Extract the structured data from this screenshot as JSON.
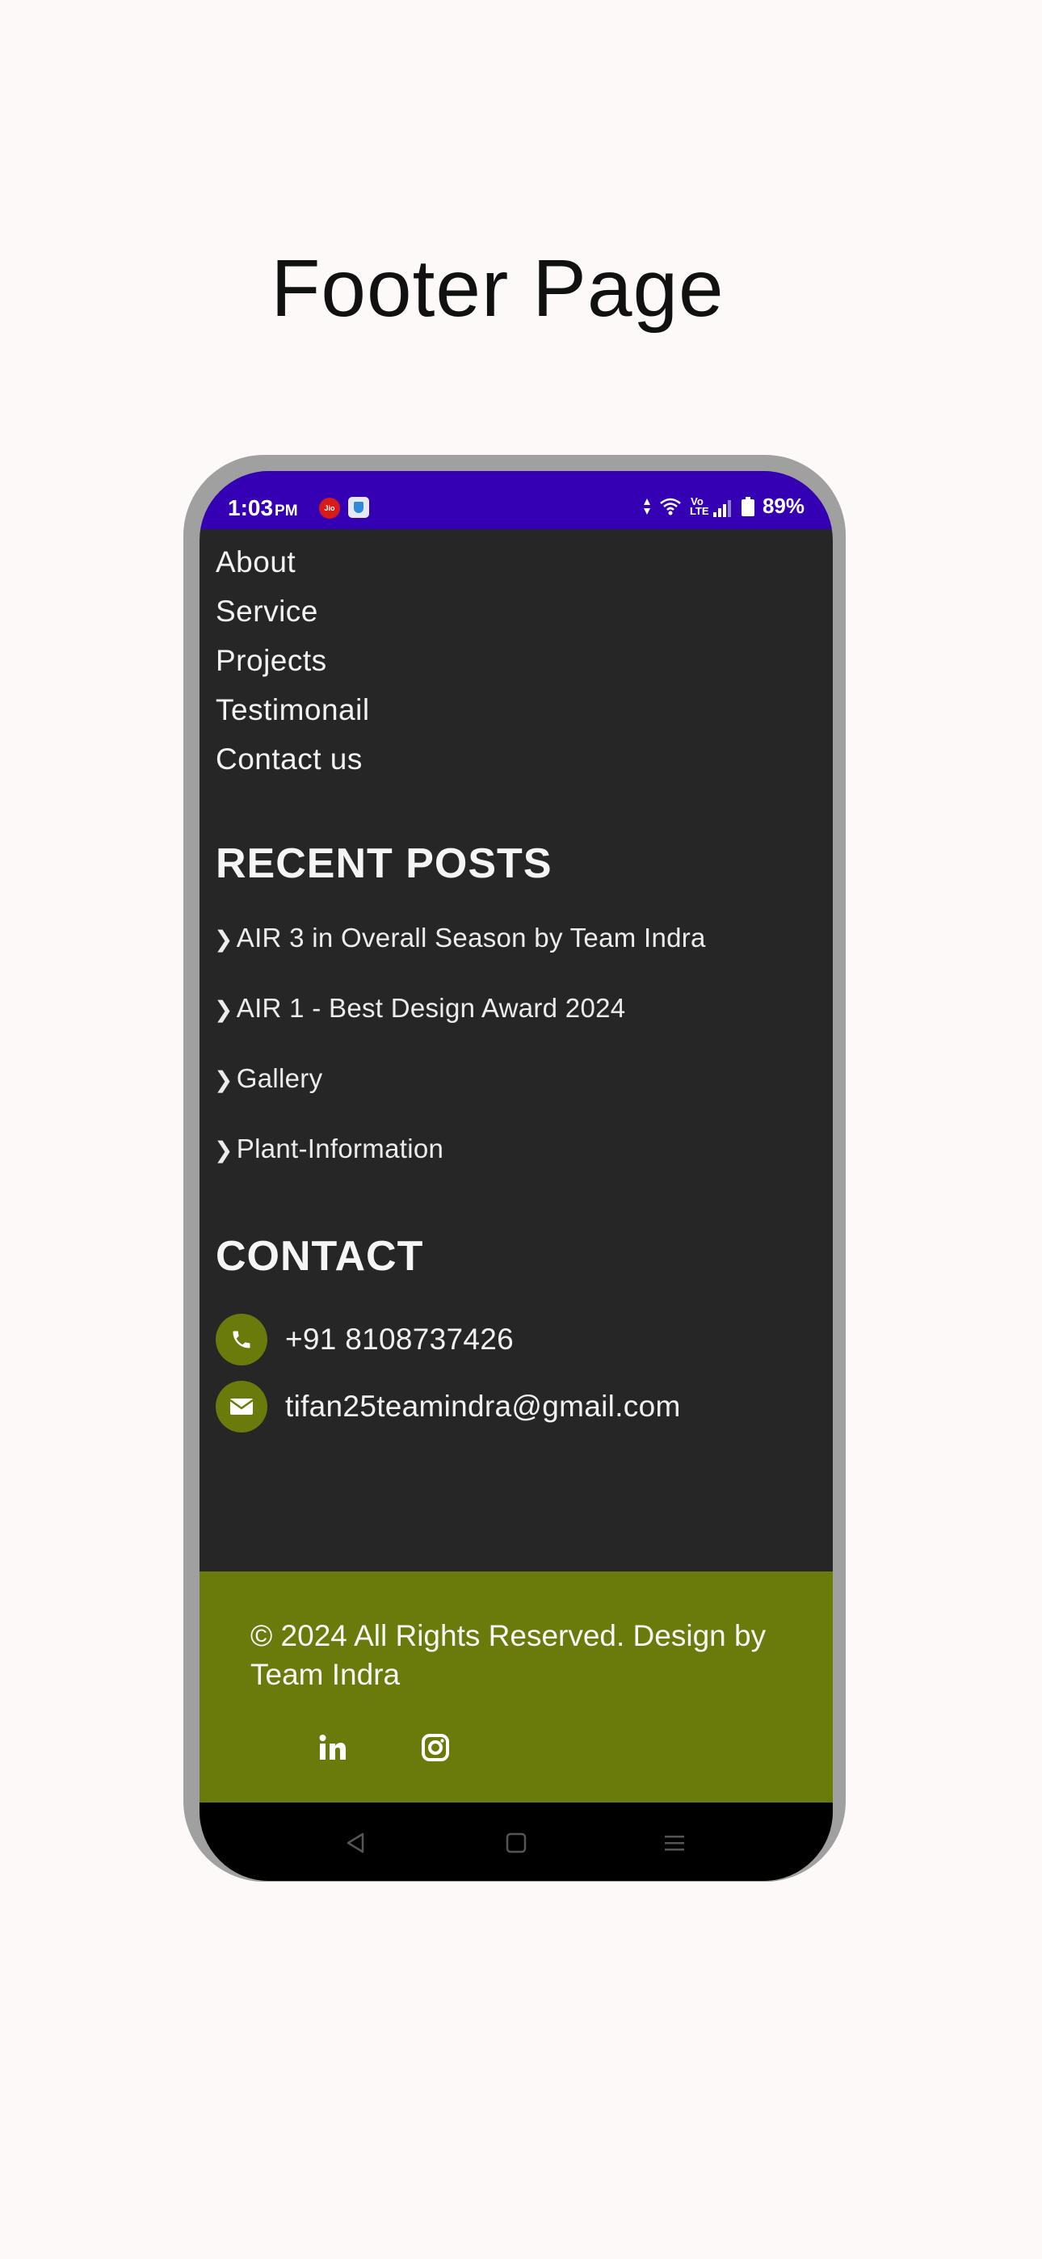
{
  "page_title": "Footer Page",
  "status_bar": {
    "time": "1:03",
    "ampm": "PM",
    "carrier_icon": "jio-icon",
    "carrier_label": "Jio",
    "volte_label": "Vo LTE",
    "battery": "89%"
  },
  "nav": {
    "items": [
      "About",
      "Service",
      "Projects",
      "Testimonail",
      "Contact us"
    ]
  },
  "recent_posts": {
    "heading": "RECENT POSTS",
    "chevron": "❯",
    "items": [
      "AIR 3 in Overall Season by Team Indra",
      "AIR 1 - Best Design Award 2024",
      "Gallery",
      "Plant-Information"
    ]
  },
  "contact": {
    "heading": "CONTACT",
    "phone": "+91 8108737426",
    "email": "tifan25teamindra@gmail.com"
  },
  "footer": {
    "copyright": "© 2024 All Rights Reserved. Design by Team Indra",
    "social": [
      "linkedin-icon",
      "instagram-icon"
    ]
  },
  "colors": {
    "status_bar": "#3500b3",
    "body_bg": "#262626",
    "accent_olive": "#6a7a0b",
    "page_bg": "#fdf9f8",
    "frame": "#a0a0a0"
  }
}
